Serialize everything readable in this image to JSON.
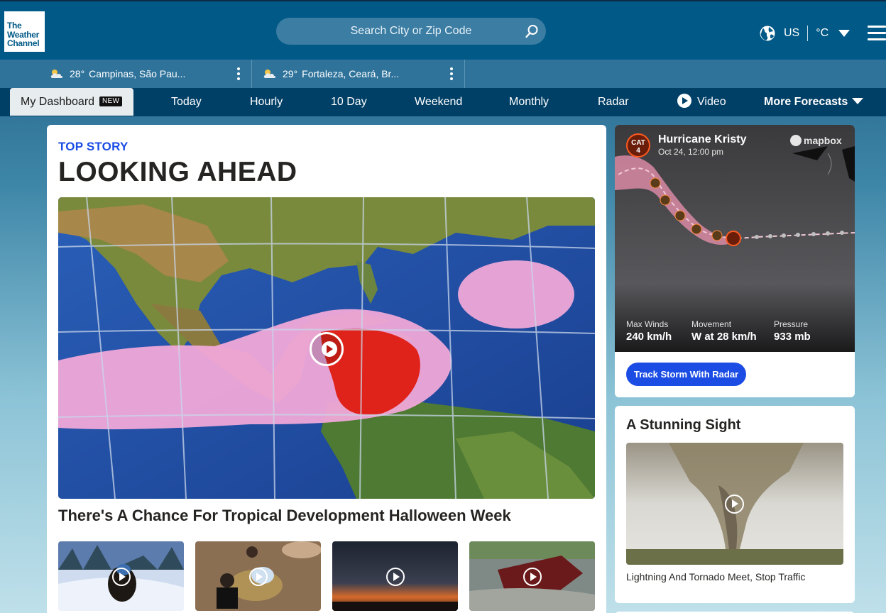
{
  "header": {
    "logo_lines": [
      "The",
      "Weather",
      "Channel"
    ],
    "search_placeholder": "Search City or Zip Code",
    "region": "US",
    "unit": "°C"
  },
  "recent_locations": [
    {
      "temp": "28°",
      "name": "Campinas, São Pau..."
    },
    {
      "temp": "29°",
      "name": "Fortaleza, Ceará, Br..."
    }
  ],
  "nav": {
    "dashboard": "My Dashboard",
    "new_badge": "NEW",
    "items": [
      "Today",
      "Hourly",
      "10 Day",
      "Weekend",
      "Monthly",
      "Radar",
      "Video",
      "More Forecasts"
    ]
  },
  "top_story": {
    "eyebrow": "TOP STORY",
    "headline": "LOOKING AHEAD",
    "title": "There's A Chance For Tropical Development Halloween Week"
  },
  "hurricane": {
    "category": "CAT",
    "category_num": "4",
    "name": "Hurricane Kristy",
    "time": "Oct 24, 12:00 pm",
    "map_brand": "mapbox",
    "stats": [
      {
        "label": "Max Winds",
        "value": "240 km/h"
      },
      {
        "label": "Movement",
        "value": "W at 28 km/h"
      },
      {
        "label": "Pressure",
        "value": "933 mb"
      }
    ],
    "button": "Track Storm With Radar"
  },
  "stunning": {
    "title": "A Stunning Sight",
    "caption": "Lightning And Tornado Meet, Stop Traffic"
  },
  "colors": {
    "header_bg": "#005986",
    "nav_bg": "#003f66",
    "accent_blue": "#1b4de4",
    "hurricane_orange": "#ff5a1f"
  }
}
